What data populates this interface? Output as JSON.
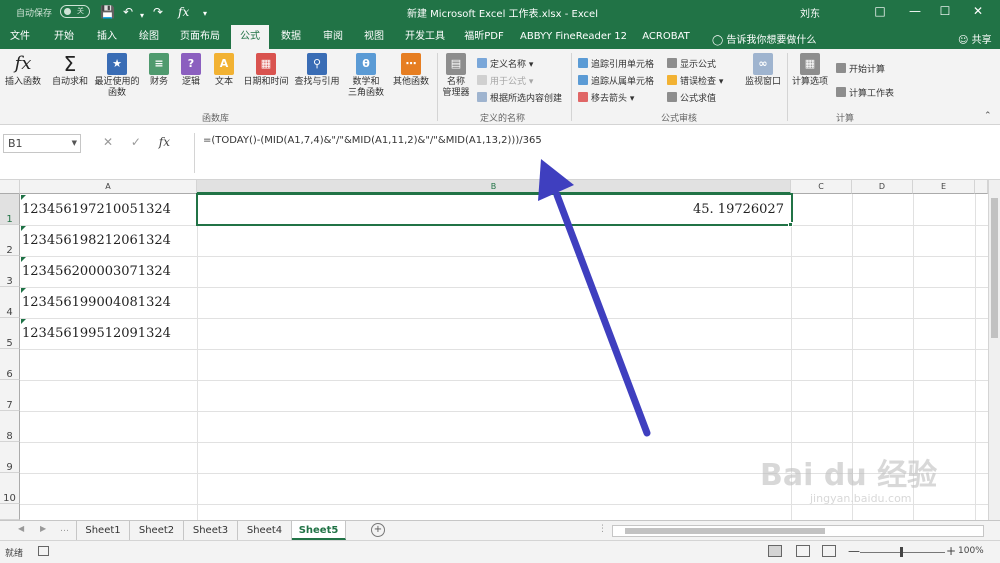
{
  "titlebar": {
    "autosave": "自动保存",
    "autosave_state": "关",
    "document_title": "新建 Microsoft Excel 工作表.xlsx  -  Excel",
    "user": "刘东"
  },
  "tabs": [
    "文件",
    "开始",
    "插入",
    "绘图",
    "页面布局",
    "公式",
    "数据",
    "审阅",
    "视图",
    "开发工具",
    "福昕PDF",
    "ABBYY FineReader 12",
    "ACROBAT"
  ],
  "active_tab": "公式",
  "tellme": "告诉我你想要做什么",
  "share": "共享",
  "ribbon": {
    "insert_function": "插入函数",
    "autosum": "自动求和",
    "recent": "最近使用的\n函数",
    "financial": "财务",
    "logical": "逻辑",
    "text": "文本",
    "datetime": "日期和时间",
    "lookup": "查找与引用",
    "math": "数学和\n三角函数",
    "other": "其他函数",
    "group_library": "函数库",
    "name_manager": "名称\n管理器",
    "define_name": "定义名称",
    "use_in_formula": "用于公式",
    "create_from_selection": "根据所选内容创建",
    "group_defined_names": "定义的名称",
    "trace_precedents": "追踪引用单元格",
    "trace_dependents": "追踪从属单元格",
    "remove_arrows": "移去箭头",
    "show_formulas": "显示公式",
    "error_checking": "错误检查",
    "evaluate_formula": "公式求值",
    "watch_window": "监视窗口",
    "group_auditing": "公式审核",
    "calc_options": "计算选项",
    "calc_now": "开始计算",
    "calc_sheet": "计算工作表",
    "group_calculation": "计算"
  },
  "formula_bar": {
    "name_box": "B1",
    "fx": "fx",
    "formula": "=(TODAY()-(MID(A1,7,4)&\"/\"&MID(A1,11,2)&\"/\"&MID(A1,13,2)))/365"
  },
  "columns": [
    "A",
    "B",
    "C",
    "D",
    "E"
  ],
  "rows": [
    "1",
    "2",
    "3",
    "4",
    "5",
    "6",
    "7",
    "8",
    "9",
    "10"
  ],
  "cells": {
    "A1": "123456197210051324",
    "A2": "123456198212061324",
    "A3": "123456200003071324",
    "A4": "123456199004081324",
    "A5": "123456199512091324",
    "B1": "45. 19726027"
  },
  "sheets": [
    "Sheet1",
    "Sheet2",
    "Sheet3",
    "Sheet4",
    "Sheet5"
  ],
  "active_sheet": "Sheet5",
  "status": {
    "ready": "就绪",
    "zoom": "100%"
  },
  "watermark": {
    "brand": "Bai du 经验",
    "url": "jingyan.baidu.com"
  },
  "colors": {
    "excel_green": "#217346",
    "arrow": "#3f3fbf"
  }
}
